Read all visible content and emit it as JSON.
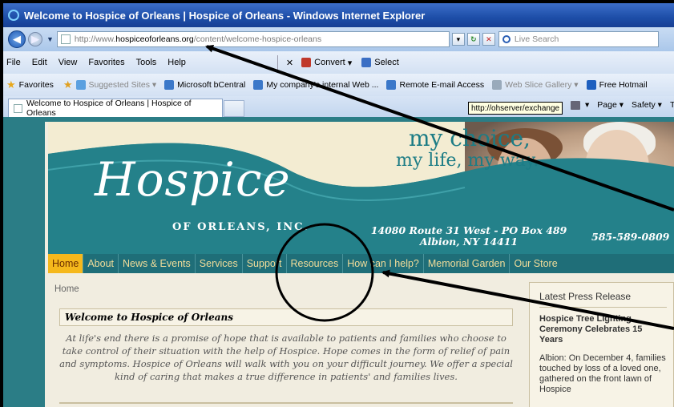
{
  "window": {
    "title": "Welcome to Hospice of Orleans | Hospice of Orleans - Windows Internet Explorer"
  },
  "address_bar": {
    "url_prefix": "http://www.",
    "url_domain": "hospiceoforleans.org",
    "url_path": "/content/welcome-hospice-orleans",
    "search_placeholder": "Live Search"
  },
  "menu": {
    "items": [
      "File",
      "Edit",
      "View",
      "Favorites",
      "Tools",
      "Help"
    ],
    "convert_label": "Convert",
    "select_label": "Select"
  },
  "favorites_bar": {
    "favorites_label": "Favorites",
    "items": [
      {
        "label": "Suggested Sites ▾",
        "dim": true
      },
      {
        "label": "Microsoft bCentral",
        "dim": false
      },
      {
        "label": "My company's internal Web ...",
        "dim": false
      },
      {
        "label": "Remote E-mail Access",
        "dim": false
      },
      {
        "label": "Web Slice Gallery ▾",
        "dim": true
      },
      {
        "label": "Free Hotmail",
        "dim": false
      }
    ]
  },
  "tabs": {
    "active_tab": "Welcome to Hospice of Orleans | Hospice of Orleans",
    "tooltip": "http://ohserver/exchange",
    "tools": [
      "Page ▾",
      "Safety ▾",
      "To"
    ]
  },
  "site": {
    "logo": "Hospice",
    "logo_sub": "OF ORLEANS, INC.",
    "tagline_line1": "my choice,",
    "tagline_line2": "my life, my way.",
    "address_line1": "14080 Route 31 West - PO Box 489",
    "address_line2": "Albion, NY 14411",
    "phone": "585-589-0809",
    "nav": [
      "Home",
      "About",
      "News & Events",
      "Services",
      "Support",
      "Resources",
      "How can I help?",
      "Memorial Garden",
      "Our Store"
    ],
    "breadcrumb": "Home",
    "welcome_heading": "Welcome to Hospice of Orleans",
    "intro": "At life's end there is a promise of hope that is available to patients and families who choose to take control of their situation with the help of Hospice. Hope comes in the form of relief of pain and symptoms. Hospice of Orleans will walk with you on your difficult journey. We offer a special kind of caring that makes a true difference in patients' and families lives.",
    "press": {
      "heading": "Latest Press Release",
      "title": "Hospice Tree Lighting Ceremony Celebrates 15 Years",
      "body": "Albion: On December 4, families touched by loss of a loved one, gathered on the front lawn of Hospice"
    }
  },
  "colors": {
    "teal": "#2b7d86",
    "nav_text": "#f2dd9a",
    "nav_active": "#f5b81c",
    "cream": "#f1ede0"
  }
}
